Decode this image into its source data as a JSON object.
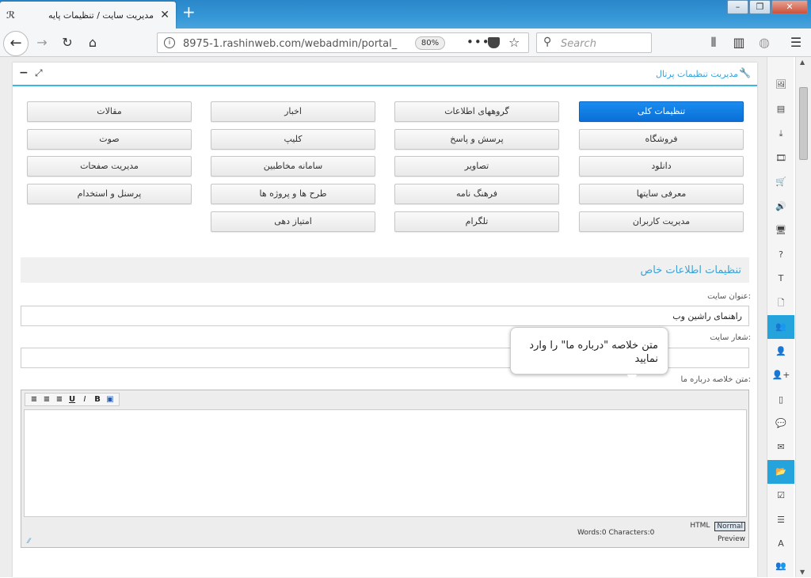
{
  "browser": {
    "tab_title": "مديريت سايت / تنظيمات پايه",
    "tab_icon": "rashinweb-favicon",
    "new_tab": "+",
    "url": "8975-1.rashinweb.com/webadmin/portal_",
    "zoom": "80%",
    "search_placeholder": "Search",
    "window_controls": {
      "min": "–",
      "restore": "❐",
      "close": "✕"
    }
  },
  "panel": {
    "title": "مديريت تنظيمات پرتال"
  },
  "nav_buttons": [
    {
      "label": "تنظيمات کلی",
      "active": true
    },
    {
      "label": "گروههای اطلاعات"
    },
    {
      "label": "اخبار"
    },
    {
      "label": "مقالات"
    },
    {
      "label": "فروشگاه"
    },
    {
      "label": "پرسش و پاسخ"
    },
    {
      "label": "کلیپ"
    },
    {
      "label": "صوت"
    },
    {
      "label": "دانلود"
    },
    {
      "label": "تصاویر"
    },
    {
      "label": "سامانه مخاطبین"
    },
    {
      "label": "مدیریت صفحات"
    },
    {
      "label": "معرفی سایتها"
    },
    {
      "label": "فرهنگ نامه"
    },
    {
      "label": "طرح ها و پروژه ها"
    },
    {
      "label": "پرسنل و استخدام"
    },
    {
      "label": "مدیریت کاربران"
    },
    {
      "label": "تلگرام"
    },
    {
      "label": "امتیاز دهی"
    }
  ],
  "section": {
    "title": "تنظیمات اطلاعات خاص",
    "site_title_label": "عنوان سایت:",
    "site_title_value": "راهنمای راشین وب",
    "slogan_label": "شعار سایت:",
    "slogan_value": "",
    "about_label": "متن خلاصه درباره ما:"
  },
  "editor": {
    "toolbar": [
      "save-icon",
      "B",
      "I",
      "U",
      "align-right-icon",
      "align-center-icon",
      "align-left-icon"
    ],
    "bold": "B",
    "italic": "I",
    "underline": "U",
    "counter": "Words:0 Characters:0",
    "mode_html": "HTML",
    "mode_normal": "Normal",
    "preview": "Preview"
  },
  "tooltip": "متن خلاصه \"درباره ما\" را وارد نمایید",
  "sidebar_icons": [
    "image-icon",
    "document-icon",
    "download-icon",
    "film-icon",
    "cart-icon",
    "speaker-icon",
    "monitor-icon",
    "question-icon",
    "text-icon",
    "page-icon",
    "contacts-icon",
    "user-icon",
    "add-user-icon",
    "mobile-icon",
    "chat-icon",
    "mail-icon",
    "folder-open-icon",
    "checkbox-icon",
    "list-icon",
    "font-icon",
    "group-icon"
  ],
  "sidebar_glyphs": [
    "🖼",
    "▤",
    "⤓",
    "🎞",
    "🛒",
    "🔊",
    "🖥",
    "?",
    "T",
    "🗋",
    "👥",
    "👤",
    "👤+",
    "▯",
    "💬",
    "✉",
    "📂",
    "☑",
    "☰",
    "A",
    "👥"
  ],
  "colors": {
    "accent": "#25a3dc",
    "active_button": "#0a6fd6",
    "tabbar": "#3597d6"
  }
}
